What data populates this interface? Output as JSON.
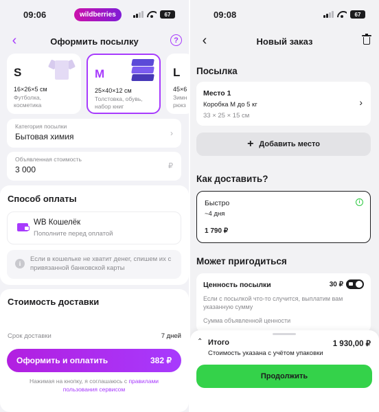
{
  "left": {
    "status": {
      "time": "09:06",
      "logo": "wildberries",
      "battery": "67"
    },
    "header": {
      "back_icon": "‹",
      "title": "Оформить посылку",
      "help_icon": "?"
    },
    "sizes": [
      {
        "letter": "S",
        "dims": "16×26×5 см",
        "desc_line1": "Футболка,",
        "desc_line2": "косметика",
        "icon": "shirt-icon"
      },
      {
        "letter": "M",
        "dims": "25×40×12 см",
        "desc_line1": "Толстовка, обувь,",
        "desc_line2": "набор книг",
        "icon": "books-icon",
        "selected": true
      },
      {
        "letter": "L",
        "dims": "45×6",
        "desc_line1": "Зимн",
        "desc_line2": "рюкз"
      }
    ],
    "category": {
      "label": "Категория посылки",
      "value": "Бытовая химия"
    },
    "declared": {
      "label": "Объявленная стоимость",
      "value": "3 000",
      "currency": "₽"
    },
    "payment": {
      "title": "Способ оплаты",
      "wallet_name": "WB Кошелёк",
      "wallet_sub": "Пополните перед оплатой",
      "info": "Если в кошельке не хватит денег, спишем их с привязанной банковской карты"
    },
    "cost": {
      "title": "Стоимость доставки",
      "term_label": "Срок доставки",
      "term_value": "7 дней",
      "pay_label": "Оформить и оплатить",
      "pay_amount": "382 ₽",
      "terms_prefix": "Нажимая на кнопку, я соглашаюсь с ",
      "terms_link": "правилами пользования сервисом"
    },
    "accent": "#a73afd"
  },
  "right": {
    "status": {
      "time": "09:08",
      "battery": "67"
    },
    "header": {
      "back_icon": "‹",
      "title": "Новый заказ"
    },
    "parcel_title": "Посылка",
    "place": {
      "title": "Место 1",
      "box": "Коробка M до 5 кг",
      "dims": "33 × 25 × 15 см"
    },
    "add_place": "Добавить место",
    "delivery_title": "Как доставить?",
    "delivery": {
      "name": "Быстро",
      "days": "~4 дня",
      "price": "1 790 ₽",
      "status_icon": "check-circle-icon"
    },
    "extras_title": "Может пригодиться",
    "value_option": {
      "title": "Ценность посылки",
      "price": "30 ₽",
      "toggle_on": true,
      "desc": "Если с посылкой что-то случится, выплатим вам указанную сумму",
      "field_label": "Сумма объявленной ценности"
    },
    "total": {
      "label": "Итого",
      "amount": "1 930,00 ₽",
      "note": "Стоимость указана с учётом упаковки"
    },
    "continue": "Продолжить",
    "accent": "#34d24a"
  }
}
